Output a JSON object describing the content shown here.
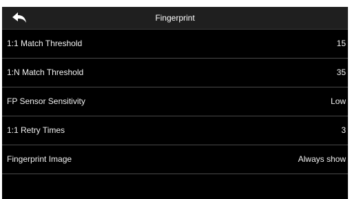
{
  "header": {
    "title": "Fingerprint",
    "back_icon": "back-arrow-icon"
  },
  "settings": [
    {
      "label": "1:1 Match Threshold",
      "value": "15"
    },
    {
      "label": "1:N Match Threshold",
      "value": "35"
    },
    {
      "label": "FP Sensor Sensitivity",
      "value": "Low"
    },
    {
      "label": "1:1 Retry Times",
      "value": "3"
    },
    {
      "label": "Fingerprint Image",
      "value": "Always show"
    }
  ],
  "colors": {
    "background": "#000000",
    "header": "#1f1f1f",
    "divider": "#4a4a4a",
    "text": "#f2f2f2"
  }
}
